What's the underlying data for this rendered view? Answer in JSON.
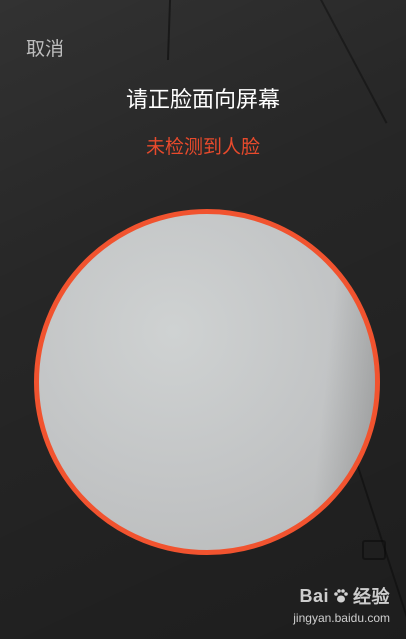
{
  "header": {
    "cancel_label": "取消"
  },
  "prompt": {
    "title": "请正脸面向屏幕",
    "status": "未检测到人脸"
  },
  "colors": {
    "ring": "#f1532f",
    "status_text": "#e84a2c",
    "title_text": "#ffffff",
    "cancel_text": "#bdbdbd",
    "background": "#272727"
  },
  "watermark": {
    "brand_left": "Bai",
    "brand_right": "经验",
    "url": "jingyan.baidu.com",
    "icon": "paw-icon"
  }
}
